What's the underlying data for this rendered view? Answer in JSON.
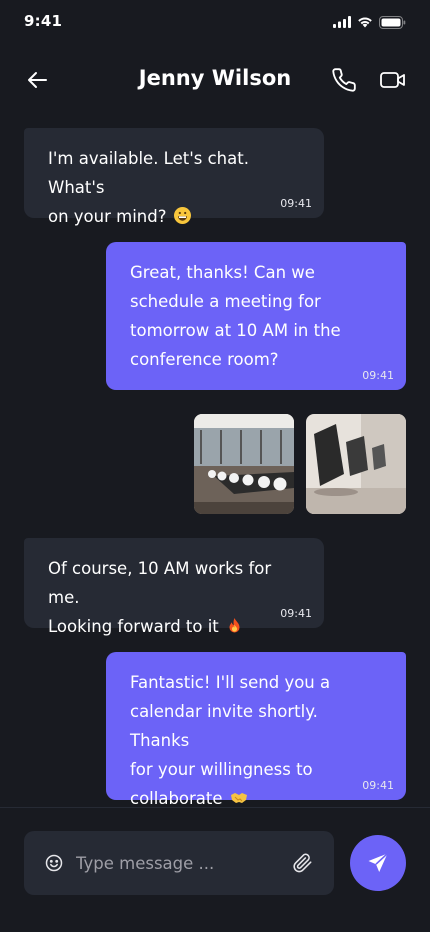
{
  "status_bar": {
    "time": "9:41"
  },
  "header": {
    "title": "Jenny Wilson",
    "back_icon": "arrow-left-icon",
    "call_icon": "phone-icon",
    "video_icon": "video-camera-icon"
  },
  "messages": [
    {
      "direction": "incoming",
      "text_lines": [
        "I'm available. Let's chat. What's",
        "on your mind?"
      ],
      "emoji": "grinning-face",
      "time": "09:41"
    },
    {
      "direction": "outgoing",
      "text_lines": [
        "Great, thanks! Can we",
        "schedule a meeting for",
        "tomorrow at 10 AM in the",
        "conference room?"
      ],
      "time": "09:41"
    },
    {
      "direction": "incoming",
      "text_lines": [
        "Of course, 10 AM works for me.",
        "Looking forward to it"
      ],
      "emoji": "fire",
      "time": "09:41"
    },
    {
      "direction": "outgoing",
      "text_lines": [
        "Fantastic! I'll send you a",
        "calendar invite shortly. Thanks",
        "for your willingness to",
        "collaborate"
      ],
      "emoji": "handshake",
      "time": "09:41"
    }
  ],
  "attachments": [
    {
      "type": "image",
      "subject": "conference-room-photo"
    },
    {
      "type": "image",
      "subject": "office-chairs-photo"
    }
  ],
  "composer": {
    "placeholder": "Type message ...",
    "value": "",
    "emoji_icon": "smiley-icon",
    "attach_icon": "paperclip-icon",
    "send_icon": "send-icon"
  },
  "colors": {
    "background": "#181a20",
    "incoming_bubble": "#262a34",
    "outgoing_bubble": "#6c63f7",
    "accent": "#6c63f7"
  }
}
